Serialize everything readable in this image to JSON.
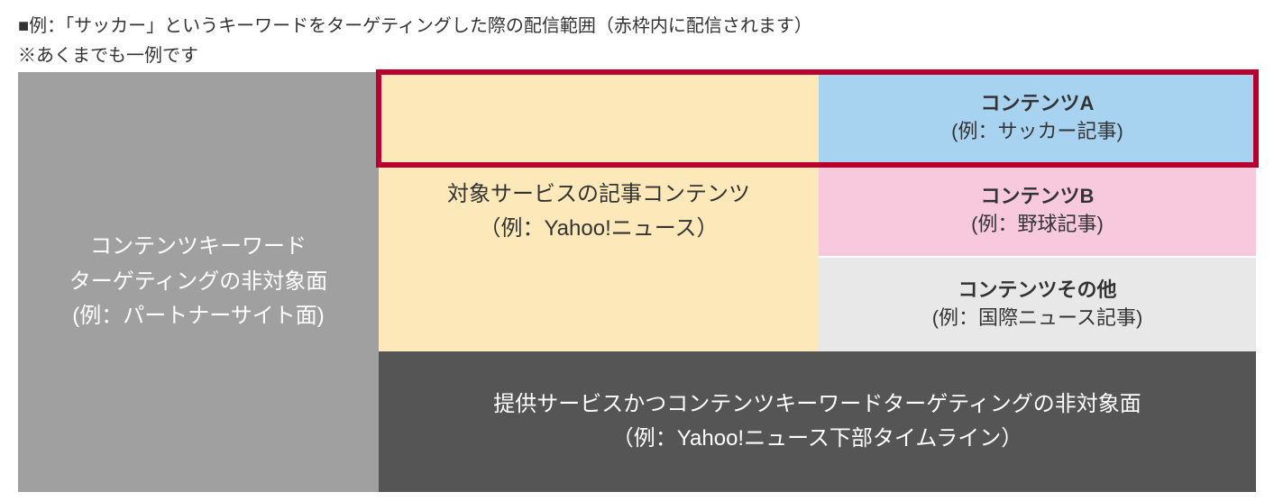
{
  "header": {
    "line1": "■例：「サッカー」というキーワードをターゲティングした際の配信範囲（赤枠内に配信されます）",
    "line2": "※あくまでも一例です"
  },
  "left": {
    "line1": "コンテンツキーワード",
    "line2": "ターゲティングの非対象面",
    "line3": "(例：パートナーサイト面)"
  },
  "middle": {
    "line1": "対象サービスの記事コンテンツ",
    "line2": "（例：Yahoo!ニュース）"
  },
  "contentA": {
    "title": "コンテンツA",
    "example": "(例：サッカー記事)"
  },
  "contentB": {
    "title": "コンテンツB",
    "example": "(例：野球記事)"
  },
  "contentOther": {
    "title": "コンテンツその他",
    "example": "(例：国際ニュース記事)"
  },
  "bottom": {
    "line1": "提供サービスかつコンテンツキーワードターゲティングの非対象面",
    "line2": "（例：Yahoo!ニュース下部タイムライン）"
  }
}
